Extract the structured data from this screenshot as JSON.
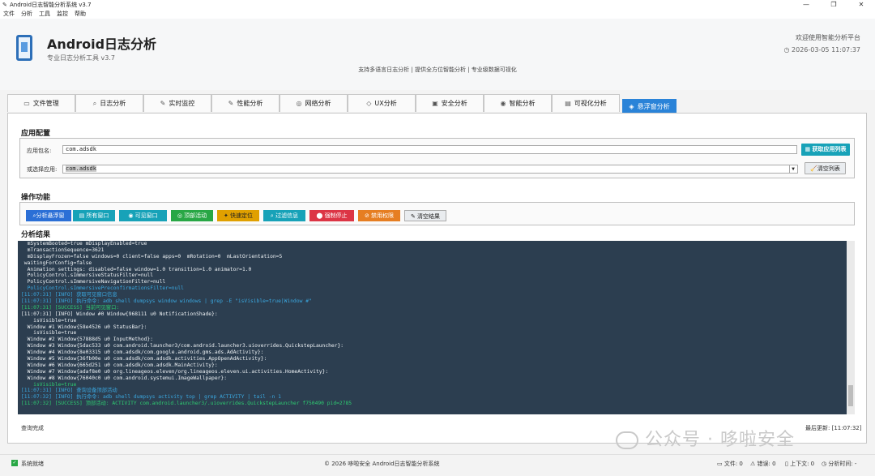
{
  "window": {
    "title": "Android日志智能分析系统 v3.7"
  },
  "menu": [
    "文件",
    "分析",
    "工具",
    "监控",
    "帮助"
  ],
  "header": {
    "title": "Android日志分析",
    "subtitle": "专业日志分析工具 v3.7",
    "welcome": "欢迎使用智能分析平台",
    "datetime": "2026-03-05 11:07:37",
    "features": "支持多语言日志分析 | 提供全方位智能分析 | 专业级数据可视化"
  },
  "tabs": [
    {
      "label": "文件管理",
      "icon": "file-icon"
    },
    {
      "label": "日志分析",
      "icon": "search-icon"
    },
    {
      "label": "实时监控",
      "icon": "tool-icon"
    },
    {
      "label": "性能分析",
      "icon": "tool-icon"
    },
    {
      "label": "网络分析",
      "icon": "globe-icon"
    },
    {
      "label": "UX分析",
      "icon": "ux-icon"
    },
    {
      "label": "安全分析",
      "icon": "shield-icon"
    },
    {
      "label": "智能分析",
      "icon": "brain-icon"
    },
    {
      "label": "可视化分析",
      "icon": "chart-icon"
    },
    {
      "label": "悬浮窗分析",
      "icon": "window-icon"
    }
  ],
  "config": {
    "title": "应用配置",
    "package_label": "应用包名:",
    "package_value": "com.adsdk",
    "get_apps_button": "获取应用列表",
    "selected_label": "或选择应用:",
    "selected_value": "com.adsdk",
    "clear_list_button": "清空列表"
  },
  "ops": {
    "title": "操作功能",
    "buttons": [
      {
        "label": "分析悬浮窗",
        "color": "#2b6fd6"
      },
      {
        "label": "所有窗口",
        "color": "#17a2b8"
      },
      {
        "label": "可见窗口",
        "color": "#17a2b8"
      },
      {
        "label": "顶部活动",
        "color": "#28a745"
      },
      {
        "label": "快速定位",
        "color": "#e0a000"
      },
      {
        "label": "过滤信息",
        "color": "#17a2b8"
      },
      {
        "label": "强制停止",
        "color": "#dc3545"
      },
      {
        "label": "禁用权限",
        "color": "#e67e22"
      },
      {
        "label": "清空结果",
        "color": "#e9ecef"
      }
    ]
  },
  "results": {
    "title": "分析结果",
    "lines": [
      {
        "text": "  mSystemBooted=true mDisplayEnabled=true",
        "c": "#eef2f5"
      },
      {
        "text": "  mTransactionSequence=3621",
        "c": "#eef2f5"
      },
      {
        "text": "  mDisplayFrozen=false windows=0 client=false apps=0  mRotation=0  mLastOrientation=5",
        "c": "#eef2f5"
      },
      {
        "text": " waitingForConfig=false",
        "c": "#eef2f5"
      },
      {
        "text": "  Animation settings: disabled=false window=1.0 transition=1.0 animator=1.0",
        "c": "#eef2f5"
      },
      {
        "text": "  PolicyControl.sImmersiveStatusFilter=null",
        "c": "#eef2f5"
      },
      {
        "text": "  PolicyControl.sImmersiveNavigationFilter=null",
        "c": "#eef2f5"
      },
      {
        "text": "  PolicyControl.sImmersivePreconfirmationsFilter=null",
        "c": "#3aa8e0"
      },
      {
        "text": "[11:07:31] [INFO] 获取可见窗口信息",
        "c": "#3aa8e0"
      },
      {
        "text": "[11:07:31] [INFO] 执行命令: adb shell dumpsys window windows | grep -E \"isVisible=true|Window #\"",
        "c": "#3aa8e0"
      },
      {
        "text": "[11:07:31] [SUCCESS] 当前可见窗口:",
        "c": "#2ecc71"
      },
      {
        "text": "[11:07:31] [INFO] Window #0 Window{968111 u0 NotificationShade}:",
        "c": "#eef2f5"
      },
      {
        "text": "    isVisible=true",
        "c": "#eef2f5"
      },
      {
        "text": "  Window #1 Window{58e4526 u0 StatusBar}:",
        "c": "#eef2f5"
      },
      {
        "text": "    isVisible=true",
        "c": "#eef2f5"
      },
      {
        "text": "  Window #2 Window{57888d5 u0 InputMethod}:",
        "c": "#eef2f5"
      },
      {
        "text": "  Window #3 Window{5dac533 u0 com.android.launcher3/com.android.launcher3.uioverrides.QuickstepLauncher}:",
        "c": "#eef2f5"
      },
      {
        "text": "  Window #4 Window{8e03315 u0 com.adsdk/com.google.android.gms.ads.AdActivity}:",
        "c": "#eef2f5"
      },
      {
        "text": "  Window #5 Window{36fb00e u0 com.adsdk/com.adsdk.activities.AppOpenAdActivity}:",
        "c": "#eef2f5"
      },
      {
        "text": "  Window #6 Window{665d251 u0 com.adsdk/com.adsdk.MainActivity}:",
        "c": "#eef2f5"
      },
      {
        "text": "  Window #7 Window{adaf8e0 u0 org.lineageos.eleven/org.lineageos.eleven.ui.activities.HomeActivity}:",
        "c": "#eef2f5"
      },
      {
        "text": "  Window #8 Window{76040c0 u0 com.android.systemui.ImageWallpaper}:",
        "c": "#eef2f5"
      },
      {
        "text": "    isVisible=true",
        "c": "#2ecc71"
      },
      {
        "text": "[11:07:31] [INFO] 查询设备顶部活动",
        "c": "#3aa8e0"
      },
      {
        "text": "[11:07:32] [INFO] 执行命令: adb shell dumpsys activity top | grep ACTIVITY | tail -n 1",
        "c": "#3aa8e0"
      },
      {
        "text": "[11:07:32] [SUCCESS] 顶部活动: ACTIVITY com.android.launcher3/.uioverrides.QuickstepLauncher f750490 pid=2785",
        "c": "#2ecc71"
      }
    ]
  },
  "panel_footer": {
    "left": "查询完成",
    "right": "最后更新: [11:07:32]"
  },
  "statusbar": {
    "ready": "系统就绪",
    "copyright": "© 2026 哆啦安全 Android日志智能分析系统",
    "files": "文件: 0",
    "errors": "错误: 0",
    "context": "上下文: 0",
    "analysis_time": "分析时间: -"
  },
  "watermark": "公众号 · 哆啦安全"
}
